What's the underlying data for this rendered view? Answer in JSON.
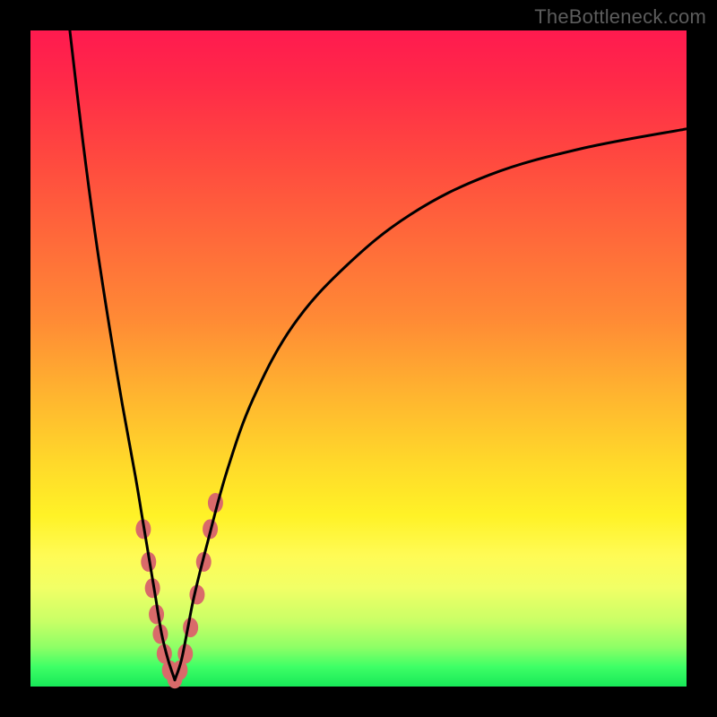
{
  "watermark": "TheBottleneck.com",
  "colors": {
    "gradient_top": "#ff1a4f",
    "gradient_mid1": "#ff8a35",
    "gradient_mid2": "#fff227",
    "gradient_bottom": "#18e858",
    "curve": "#000000",
    "marker": "#d96a6a",
    "background": "#000000"
  },
  "chart_data": {
    "type": "line",
    "title": "",
    "xlabel": "",
    "ylabel": "",
    "xlim": [
      0,
      100
    ],
    "ylim": [
      0,
      100
    ],
    "grid": false,
    "legend": false,
    "note": "V-shaped bottleneck curve; y = 100 top, 0 bottom. Minimum near x ≈ 22.",
    "series": [
      {
        "name": "left-branch",
        "x": [
          6,
          8,
          10,
          12,
          14,
          16,
          17,
          18,
          19,
          20,
          21,
          22
        ],
        "y": [
          100,
          83,
          68,
          55,
          43,
          32,
          26,
          20,
          14,
          8,
          4,
          1
        ]
      },
      {
        "name": "right-branch",
        "x": [
          22,
          23,
          24,
          25,
          27,
          30,
          34,
          40,
          48,
          58,
          70,
          84,
          100
        ],
        "y": [
          1,
          4,
          9,
          14,
          22,
          33,
          44,
          55,
          64,
          72,
          78,
          82,
          85
        ]
      }
    ],
    "markers": {
      "name": "highlighted-points",
      "note": "salmon-colored dots clustered near the trough of the V",
      "x": [
        17.2,
        18.0,
        18.6,
        19.2,
        19.8,
        20.4,
        21.2,
        22.0,
        22.8,
        23.6,
        24.4,
        25.4,
        26.4,
        27.4,
        28.2
      ],
      "y": [
        24,
        19,
        15,
        11,
        8,
        5,
        2.5,
        1.2,
        2.5,
        5,
        9,
        14,
        19,
        24,
        28
      ]
    }
  }
}
